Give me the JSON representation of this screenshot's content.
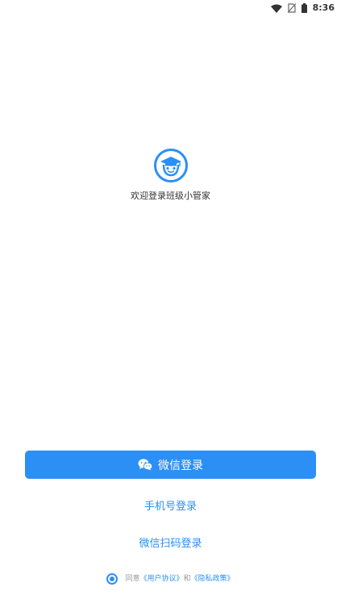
{
  "status_bar": {
    "time": "8:36",
    "icons": [
      "wifi-icon",
      "no-sim-icon",
      "battery-icon"
    ]
  },
  "app": {
    "logo_icon": "student-graduation-cap-logo",
    "welcome_text": "欢迎登录班级小管家"
  },
  "login": {
    "wechat_button_label": "微信登录",
    "wechat_button_icon": "wechat-icon",
    "phone_login_label": "手机号登录",
    "wechat_qr_login_label": "微信扫码登录"
  },
  "agreement": {
    "agree_prefix": "同意",
    "user_agreement": "《用户协议》",
    "and_text": "和",
    "privacy_policy": "《隐私政策》",
    "checked": true
  },
  "colors": {
    "primary": "#2b8ff5",
    "background": "#ffffff",
    "muted_text": "#999999"
  }
}
